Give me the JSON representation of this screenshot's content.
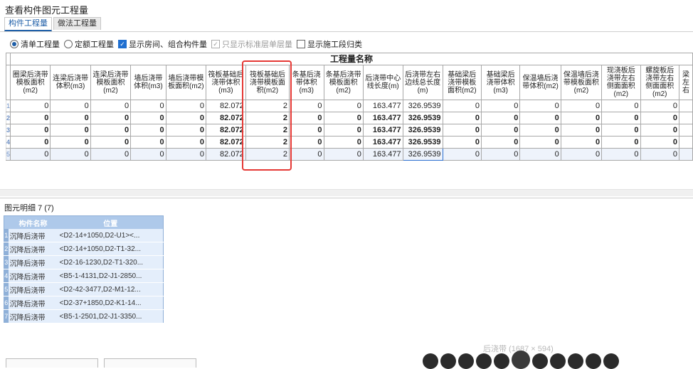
{
  "window_title": "查看构件图元工程量",
  "tabs": [
    {
      "label": "构件工程量",
      "active": true
    },
    {
      "label": "做法工程量",
      "active": false
    }
  ],
  "options": {
    "list_qty": "清单工程量",
    "quota_qty": "定额工程量",
    "show_rooms": "显示房间、组合构件量",
    "std_floor_only": "只显示标准层单层量",
    "show_stage": "显示施工段归类"
  },
  "table": {
    "group_header": "工程量名称",
    "columns": [
      "圈梁后浇带模板面积(m2)",
      "连梁后浇带体积(m3)",
      "连梁后浇带模板面积(m2)",
      "墙后浇带体积(m3)",
      "墙后浇带模板面积(m2)",
      "筏板基础后浇带体积(m3)",
      "筏板基础后浇带模板面积(m2)",
      "条基后浇带体积(m3)",
      "条基后浇带模板面积(m2)",
      "后浇带中心线长度(m)",
      "后浇带左右边线总长度(m)",
      "基础梁后浇带模板面积(m2)",
      "基础梁后浇带体积(m3)",
      "保温墙后浇带体积(m2)",
      "保温墙后浇带模板面积(m2)",
      "现浇板后浇带左右侧面面积(m2)",
      "螺旋板后浇带左右侧面面积(m2)",
      "梁左右"
    ],
    "rows": [
      {
        "num": "1",
        "cells": [
          "0",
          "0",
          "0",
          "0",
          "0",
          "82.072",
          "2",
          "0",
          "0",
          "163.477",
          "326.9539",
          "0",
          "0",
          "0",
          "0",
          "0",
          "0",
          ""
        ]
      },
      {
        "num": "2",
        "cells": [
          "0",
          "0",
          "0",
          "0",
          "0",
          "82.072",
          "2",
          "0",
          "0",
          "163.477",
          "326.9539",
          "0",
          "0",
          "0",
          "0",
          "0",
          "0",
          ""
        ]
      },
      {
        "num": "3",
        "cells": [
          "0",
          "0",
          "0",
          "0",
          "0",
          "82.072",
          "2",
          "0",
          "0",
          "163.477",
          "326.9539",
          "0",
          "0",
          "0",
          "0",
          "0",
          "0",
          ""
        ]
      },
      {
        "num": "4",
        "cells": [
          "0",
          "0",
          "0",
          "0",
          "0",
          "82.072",
          "2",
          "0",
          "0",
          "163.477",
          "326.9539",
          "0",
          "0",
          "0",
          "0",
          "0",
          "0",
          ""
        ]
      },
      {
        "num": "5",
        "cells": [
          "0",
          "0",
          "0",
          "0",
          "0",
          "82.072",
          "2",
          "0",
          "0",
          "163.477",
          "326.9539",
          "0",
          "0",
          "0",
          "0",
          "0",
          "0",
          ""
        ]
      }
    ]
  },
  "detail": {
    "label": "图元明细",
    "count": "7 (7)",
    "col_name": "构件名称",
    "col_pos": "位置",
    "rows": [
      {
        "num": "1",
        "name": "沉降后浇带",
        "pos": "<D2-14+1050,D2-U1><..."
      },
      {
        "num": "2",
        "name": "沉降后浇带",
        "pos": "<D2-14+1050,D2-T1-32..."
      },
      {
        "num": "3",
        "name": "沉降后浇带",
        "pos": "<D2-16-1230,D2-T1-320..."
      },
      {
        "num": "4",
        "name": "沉降后浇带",
        "pos": "<B5-1-4131,D2-J1-2850..."
      },
      {
        "num": "5",
        "name": "沉降后浇带",
        "pos": "<D2-42-3477,D2-M1-12..."
      },
      {
        "num": "6",
        "name": "沉降后浇带",
        "pos": "<D2-37+1850,D2-K1-14..."
      },
      {
        "num": "7",
        "name": "沉降后浇带",
        "pos": "<B5-1-2501,D2-J1-3350..."
      }
    ]
  },
  "watermark": "后浇带 (1687 × 594)"
}
